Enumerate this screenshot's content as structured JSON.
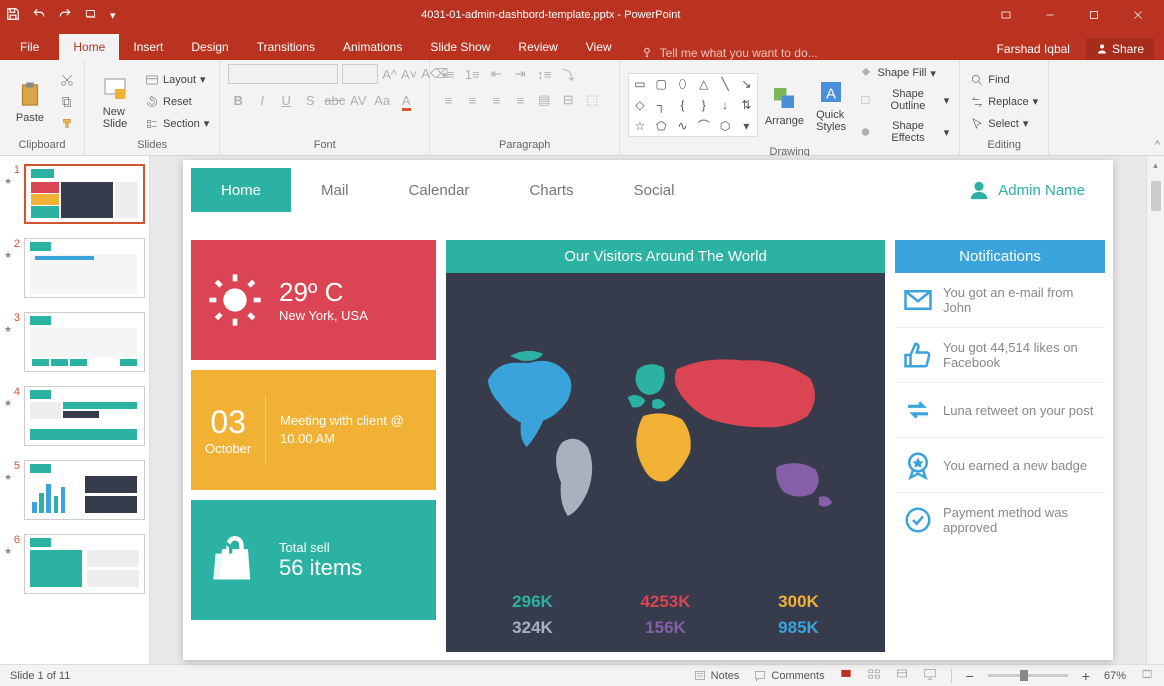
{
  "app": {
    "title": "4031-01-admin-dashbord-template.pptx - PowerPoint"
  },
  "user": {
    "name": "Farshad Iqbal",
    "share": "Share"
  },
  "menus": [
    "File",
    "Home",
    "Insert",
    "Design",
    "Transitions",
    "Animations",
    "Slide Show",
    "Review",
    "View"
  ],
  "tellme": "Tell me what you want to do...",
  "ribbon": {
    "clipboard": {
      "paste": "Paste",
      "label": "Clipboard"
    },
    "slides": {
      "newslide": "New\nSlide",
      "layout": "Layout",
      "reset": "Reset",
      "section": "Section",
      "label": "Slides"
    },
    "font": {
      "label": "Font"
    },
    "paragraph": {
      "label": "Paragraph"
    },
    "drawing": {
      "arrange": "Arrange",
      "quick": "Quick\nStyles",
      "fill": "Shape Fill",
      "outline": "Shape Outline",
      "effects": "Shape Effects",
      "label": "Drawing"
    },
    "editing": {
      "find": "Find",
      "replace": "Replace",
      "select": "Select",
      "label": "Editing"
    }
  },
  "status": {
    "slide": "Slide 1 of 11",
    "notes": "Notes",
    "comments": "Comments",
    "zoom": "67%"
  },
  "thumbs": [
    1,
    2,
    3,
    4,
    5,
    6
  ],
  "dash": {
    "tabs": [
      "Home",
      "Mail",
      "Calendar",
      "Charts",
      "Social"
    ],
    "admin": "Admin Name",
    "weather": {
      "temp": "29º C",
      "loc": "New York, USA"
    },
    "meeting": {
      "day": "03",
      "month": "October",
      "text": "Meeting with client @ 10.00 AM"
    },
    "sales": {
      "label": "Total sell",
      "value": "56 items"
    },
    "visitors_title": "Our Visitors Around The World",
    "stats": [
      {
        "v": "296K",
        "c": "#2bb2a3"
      },
      {
        "v": "4253K",
        "c": "#da4453"
      },
      {
        "v": "300K",
        "c": "#f1b134"
      },
      {
        "v": "324K",
        "c": "#aab0bd"
      },
      {
        "v": "156K",
        "c": "#8560a8"
      },
      {
        "v": "985K",
        "c": "#3ba3db"
      }
    ],
    "notif_title": "Notifications",
    "notifs": [
      "You got an e-mail from John",
      "You got 44,514 likes on Facebook",
      "Luna retweet on your post",
      "You earned a new badge",
      "Payment method was approved"
    ]
  }
}
